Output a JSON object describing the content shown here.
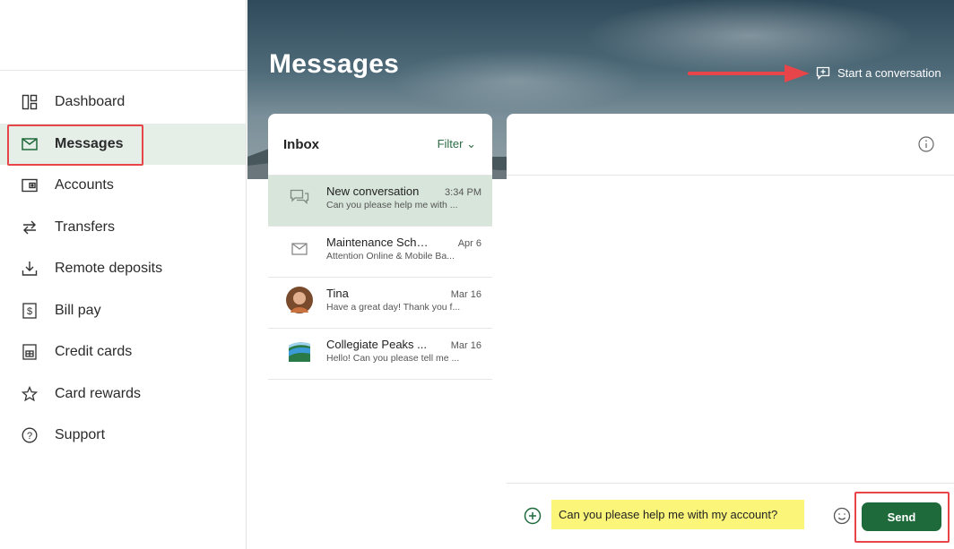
{
  "page": {
    "title": "Messages"
  },
  "header": {
    "start_conversation_label": "Start a conversation"
  },
  "sidebar": {
    "items": [
      {
        "label": "Dashboard",
        "icon": "dashboard-icon"
      },
      {
        "label": "Messages",
        "icon": "envelope-icon",
        "active": true
      },
      {
        "label": "Accounts",
        "icon": "wallet-icon"
      },
      {
        "label": "Transfers",
        "icon": "transfer-arrows-icon"
      },
      {
        "label": "Remote deposits",
        "icon": "download-tray-icon"
      },
      {
        "label": "Bill pay",
        "icon": "dollar-receipt-icon"
      },
      {
        "label": "Credit cards",
        "icon": "credit-card-icon"
      },
      {
        "label": "Card rewards",
        "icon": "star-icon"
      },
      {
        "label": "Support",
        "icon": "help-circle-icon"
      }
    ]
  },
  "inbox": {
    "title": "Inbox",
    "filter_label": "Filter ⌄",
    "conversations": [
      {
        "name": "New conversation",
        "time": "3:34 PM",
        "preview": "Can you please help me with ...",
        "icon": "chat-bubble-icon",
        "selected": true
      },
      {
        "name": "Maintenance Sche...",
        "time": "Apr 6",
        "preview": "Attention Online & Mobile Ba...",
        "icon": "envelope-icon"
      },
      {
        "name": "Tina",
        "time": "Mar 16",
        "preview": "Have a great day! Thank you f...",
        "icon": "avatar"
      },
      {
        "name": "Collegiate Peaks ...",
        "time": "Mar 16",
        "preview": "Hello! Can you please tell me ...",
        "icon": "bank-logo"
      }
    ]
  },
  "composer": {
    "message_value": "Can you please help me with my account?",
    "send_label": "Send"
  },
  "colors": {
    "accent_green": "#1e6a3b",
    "active_nav_bg": "#e5efe8",
    "selected_conv_bg": "#d7e5da",
    "highlight_red": "#e8454a",
    "input_highlight": "#fbf67a"
  }
}
